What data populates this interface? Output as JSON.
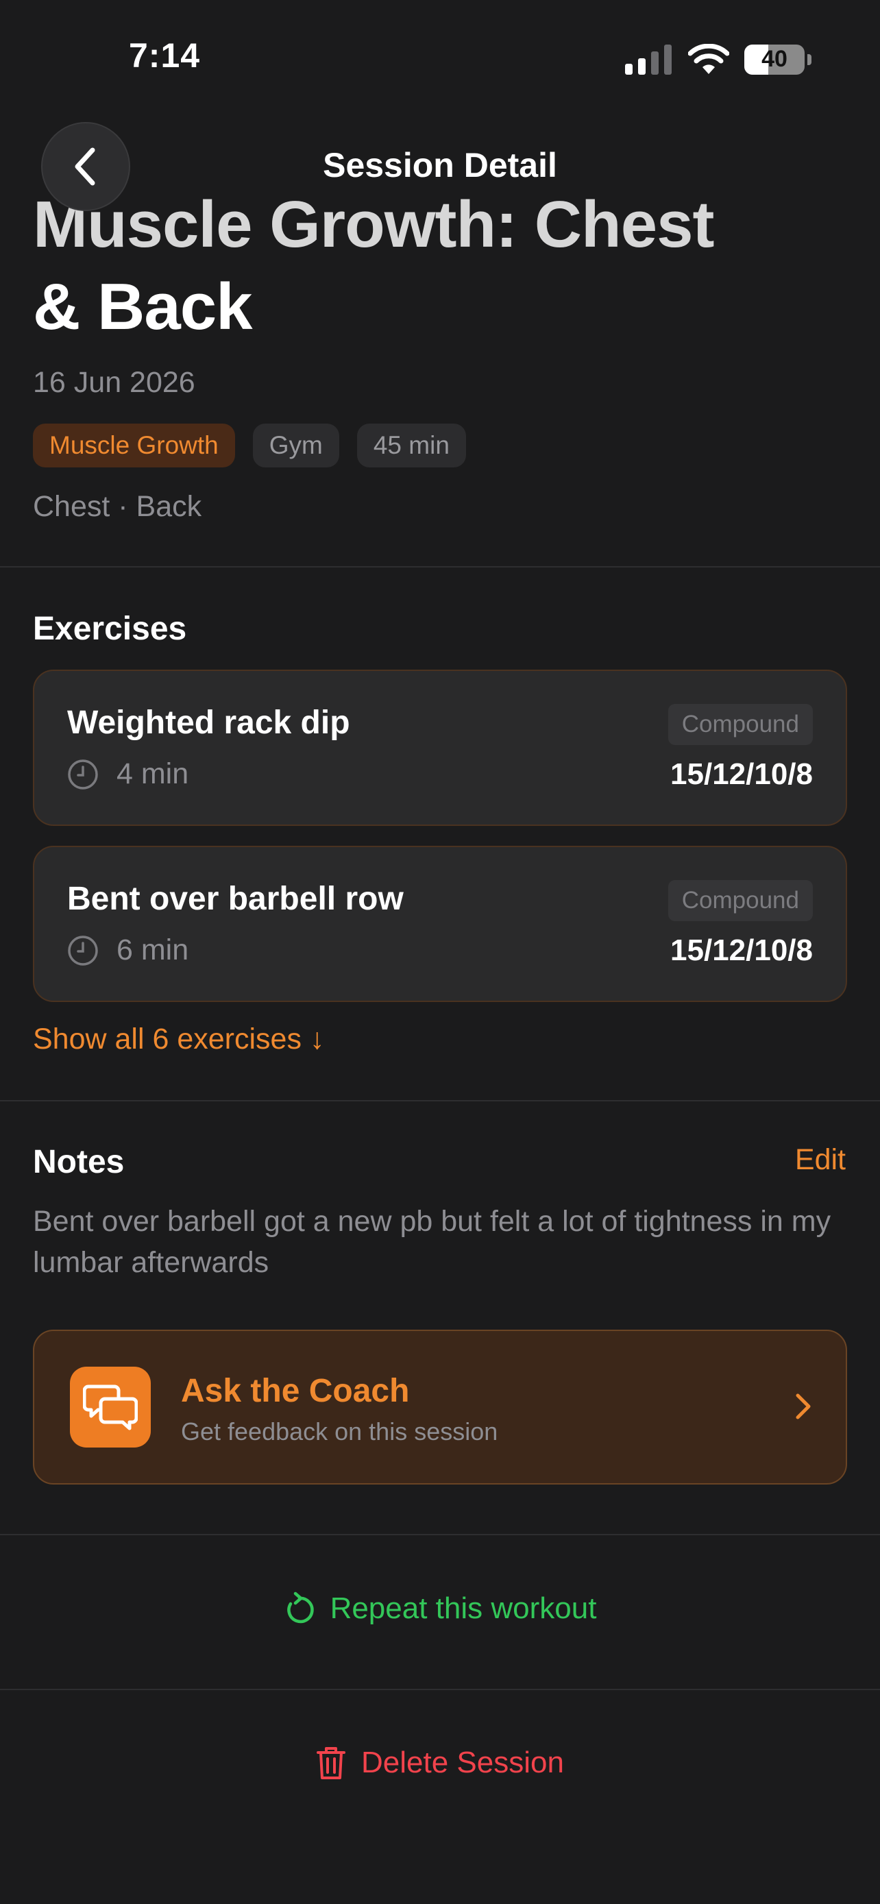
{
  "status_bar": {
    "time": "7:14",
    "battery": "40",
    "battery_level": 0.4
  },
  "nav": {
    "title": "Session Detail",
    "back_icon": "chevron-left-icon"
  },
  "session": {
    "title_line1": "Muscle Growth: Chest",
    "title_line2": "& Back",
    "date": "16 Jun 2026",
    "tags": [
      {
        "label": "Muscle Growth",
        "accent": true
      },
      {
        "label": "Gym",
        "accent": false
      },
      {
        "label": "45 min",
        "accent": false
      }
    ],
    "muscles": "Chest · Back"
  },
  "exercises": {
    "heading": "Exercises",
    "items": [
      {
        "name": "Weighted rack dip",
        "duration": "4 min",
        "badge": "Compound",
        "sets": "15/12/10/8"
      },
      {
        "name": "Bent over barbell row",
        "duration": "6 min",
        "badge": "Compound",
        "sets": "15/12/10/8"
      }
    ],
    "show_all": "Show all 6 exercises ↓"
  },
  "notes": {
    "heading": "Notes",
    "edit_label": "Edit",
    "text": "Bent over barbell got a new pb but felt a lot of tightness in my lumbar afterwards"
  },
  "coach": {
    "title": "Ask the Coach",
    "subtitle": "Get feedback on this session",
    "icon": "chat-bubbles-icon"
  },
  "actions": {
    "repeat_label": "Repeat this workout",
    "delete_label": "Delete Session"
  },
  "colors": {
    "accent": "#f08a30",
    "repeat": "#33c759",
    "delete": "#f2434c",
    "background": "#1b1b1c"
  }
}
